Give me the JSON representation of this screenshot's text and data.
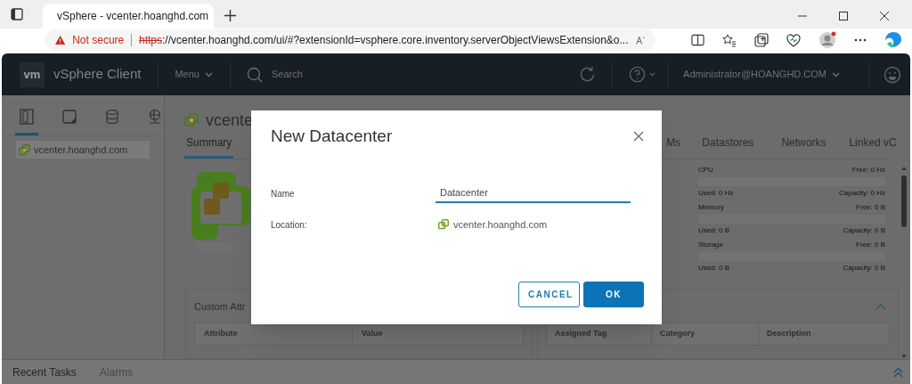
{
  "browser": {
    "tab_title": "vSphere - vcenter.hoanghd.com",
    "url_warning": "Not secure",
    "url_scheme": "https",
    "url_rest": "://vcenter.hoanghd.com/ui/#?extensionId=vsphere.core.inventory.serverObjectViewsExtension&o..."
  },
  "header": {
    "logo": "vm",
    "app_name": "vSphere Client",
    "menu": "Menu",
    "search_placeholder": "Search",
    "user": "Administrator@HOANGHD.COM"
  },
  "sidebar": {
    "view_tabs": [
      {
        "kind": "hosts",
        "selected": true
      },
      {
        "kind": "vms",
        "selected": false
      },
      {
        "kind": "storage",
        "selected": false
      },
      {
        "kind": "network",
        "selected": false
      }
    ],
    "tree": [
      {
        "label": "vcenter.hoanghd.com",
        "selected": true
      }
    ]
  },
  "main": {
    "title": "vcente",
    "tabs": [
      {
        "label": "Summary",
        "selected": true
      },
      {
        "label": "Ms",
        "selected": false
      },
      {
        "label": "Datastores",
        "selected": false
      },
      {
        "label": "Networks",
        "selected": false
      },
      {
        "label": "Linked vC",
        "selected": false
      }
    ],
    "resources": [
      {
        "name": "CPU",
        "free": "Free: 0 Hz",
        "used": "Used: 0 Hz",
        "capacity": "Capacity: 0 Hz",
        "level": 0
      },
      {
        "name": "Memory",
        "free": "Free: 0 B",
        "used": "Used: 0 B",
        "capacity": "Capacity: 0 B",
        "level": 0
      },
      {
        "name": "Storage",
        "free": "Free: 0 B",
        "used": "Used: 0 B",
        "capacity": "Capacity: 0 B",
        "level": 0
      }
    ],
    "custom_attributes": {
      "title": "Custom Attr",
      "columns": [
        "Attribute",
        "Value"
      ]
    },
    "tags": {
      "expanded": true,
      "columns": [
        "Assigned Tag",
        "Category",
        "Description"
      ]
    }
  },
  "bottom_bar": {
    "tabs": [
      {
        "label": "Recent Tasks",
        "selected": true
      },
      {
        "label": "Alarms",
        "selected": false
      }
    ]
  },
  "dialog": {
    "title": "New Datacenter",
    "name_label": "Name",
    "name_value": "Datacenter",
    "location_label": "Location:",
    "location_value": "vcenter.hoanghd.com",
    "buttons": [
      {
        "kind": "secondary",
        "label": "CANCEL"
      },
      {
        "kind": "primary",
        "label": "OK"
      }
    ]
  }
}
